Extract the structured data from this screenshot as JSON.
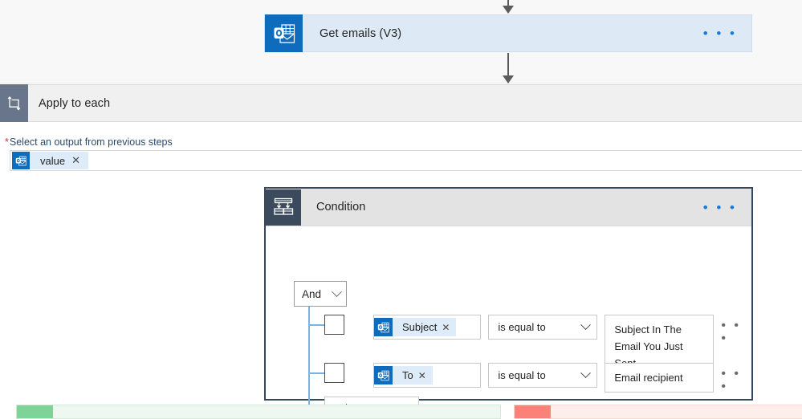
{
  "flow": {
    "get_emails": {
      "title": "Get emails (V3)",
      "icon": "outlook-icon",
      "menu": "• • •"
    },
    "apply_to_each": {
      "title": "Apply to each",
      "icon": "loop-icon",
      "field_label": "Select an output from previous steps",
      "required_marker": "*",
      "token": {
        "text": "value",
        "icon": "outlook-icon",
        "remove": "✕"
      }
    },
    "condition": {
      "title": "Condition",
      "icon": "condition-branch-icon",
      "menu": "• • •",
      "logic_operator": "And",
      "rows": [
        {
          "checkbox_checked": false,
          "token": {
            "text": "Subject",
            "icon": "outlook-icon",
            "remove": "✕"
          },
          "operator": "is equal to",
          "value": "Subject In The Email You Just Sent",
          "menu": "• • •"
        },
        {
          "checkbox_checked": false,
          "token": {
            "text": "To",
            "icon": "outlook-icon",
            "remove": "✕"
          },
          "operator": "is equal to",
          "value": "Email recipient",
          "menu": "• • •"
        }
      ],
      "add_button": "Add"
    },
    "branches": {
      "if_yes": {
        "label": "",
        "accent": "#7ed396",
        "fill": "#eef8f0",
        "border": "#d4e9d9"
      },
      "if_no": {
        "label": "",
        "accent": "#fa8278",
        "fill": "#fdeeec",
        "border": "#f6d9d5"
      }
    }
  },
  "colors": {
    "outlook_blue": "#0f6cbd",
    "card_fill": "#ddeaf6",
    "scope_icon": "#69758a",
    "condition_icon": "#3b4a5c",
    "panel_border": "#37485c",
    "tree_line": "#7cb1e0",
    "token_fill": "#deecf9",
    "required_red": "#d13438",
    "label_blue": "#2c4a6b"
  }
}
